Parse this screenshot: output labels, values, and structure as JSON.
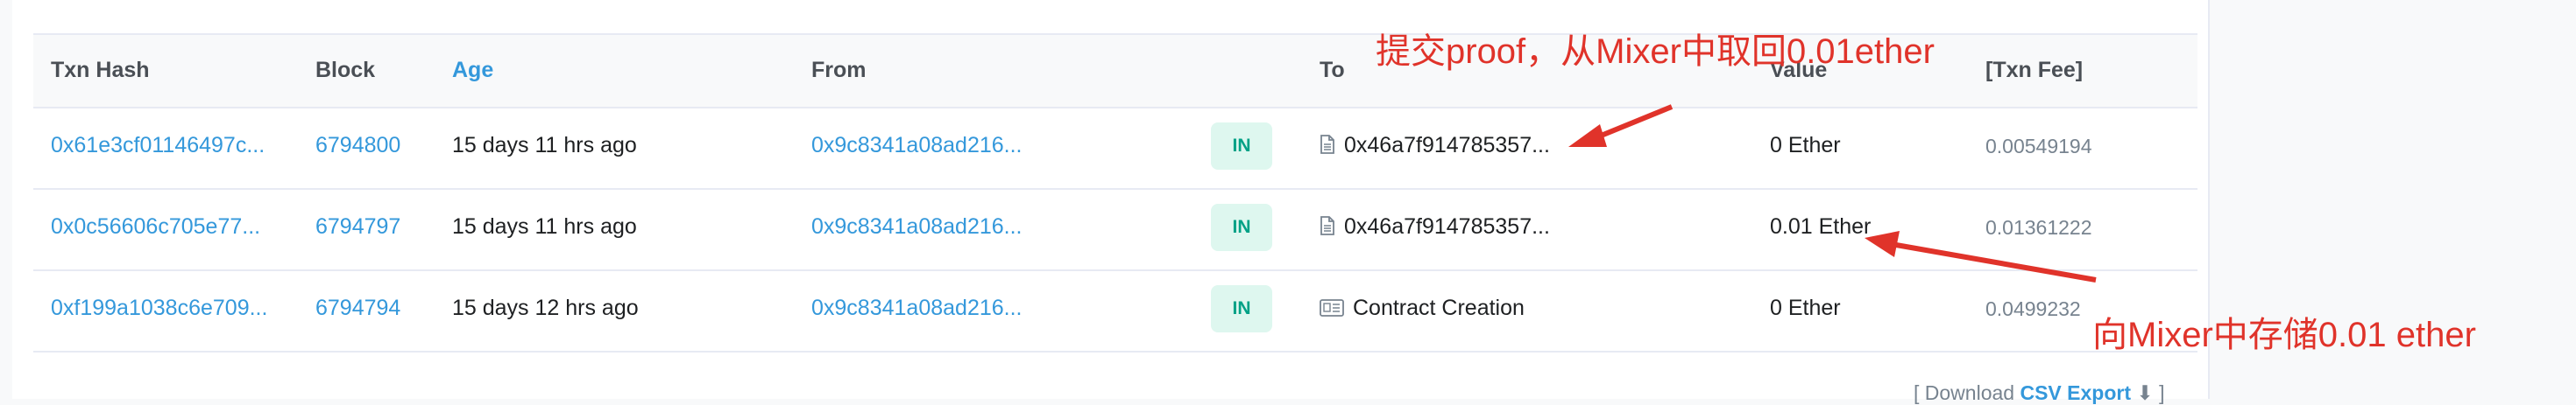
{
  "table": {
    "headers": {
      "txn_hash": "Txn Hash",
      "block": "Block",
      "age": "Age",
      "from": "From",
      "to": "To",
      "value": "Value",
      "fee": "[Txn Fee]"
    },
    "rows": [
      {
        "hash": "0x61e3cf01146497c...",
        "block": "6794800",
        "age": "15 days 11 hrs ago",
        "from": "0x9c8341a08ad216...",
        "direction": "IN",
        "to": "0x46a7f914785357...",
        "to_icon": "file-icon",
        "value": "0 Ether",
        "fee": "0.00549194"
      },
      {
        "hash": "0x0c56606c705e77...",
        "block": "6794797",
        "age": "15 days 11 hrs ago",
        "from": "0x9c8341a08ad216...",
        "direction": "IN",
        "to": "0x46a7f914785357...",
        "to_icon": "file-icon",
        "value": "0.01 Ether",
        "fee": "0.01361222"
      },
      {
        "hash": "0xf199a1038c6e709...",
        "block": "6794794",
        "age": "15 days 12 hrs ago",
        "from": "0x9c8341a08ad216...",
        "direction": "IN",
        "to": "Contract Creation",
        "to_icon": "contract-creation-icon",
        "value": "0 Ether",
        "fee": "0.0499232"
      }
    ]
  },
  "footer": {
    "prefix": "[ Download",
    "csv_label": "CSV Export",
    "suffix": "]"
  },
  "annotations": {
    "top": "提交proof，从Mixer中取回0.01ether",
    "bottom": "向Mixer中存储0.01 ether",
    "color": "#e0332a"
  },
  "colors": {
    "link": "#3498db",
    "badge_bg": "#def7ef",
    "badge_text": "#00a186"
  }
}
